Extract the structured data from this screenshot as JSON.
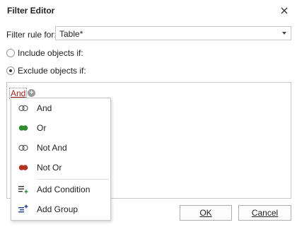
{
  "dialog": {
    "title": "Filter Editor"
  },
  "filter_rule": {
    "label": "Filter rule for:",
    "value": "Table*"
  },
  "options": {
    "include_label": "Include objects if:",
    "exclude_label": "Exclude objects if:",
    "selected": "exclude"
  },
  "editor": {
    "group_operator": "And"
  },
  "menu": {
    "items": [
      {
        "label": "And",
        "icon": "and-icon"
      },
      {
        "label": "Or",
        "icon": "or-icon"
      },
      {
        "label": "Not And",
        "icon": "not-and-icon"
      },
      {
        "label": "Not Or",
        "icon": "not-or-icon"
      },
      {
        "label": "Add Condition",
        "icon": "add-condition-icon"
      },
      {
        "label": "Add Group",
        "icon": "add-group-icon"
      }
    ]
  },
  "buttons": {
    "ok": "OK",
    "cancel": "Cancel"
  },
  "colors": {
    "or_green": "#2e8b2e",
    "not_or_red": "#b0341f",
    "link_red": "#a02020"
  }
}
